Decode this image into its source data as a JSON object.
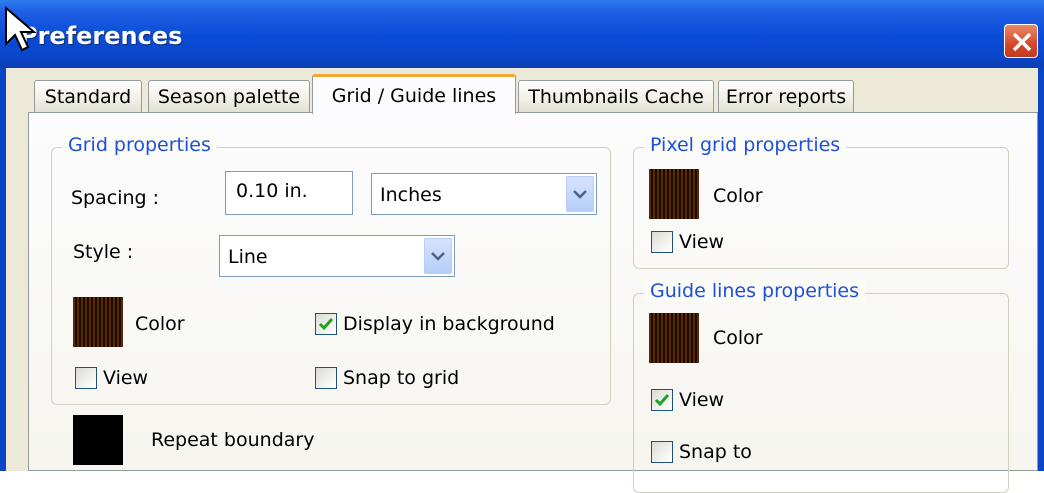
{
  "window": {
    "title": "Preferences",
    "close_icon": "close-icon"
  },
  "tabs": [
    {
      "label": "Standard",
      "active": false
    },
    {
      "label": "Season palette",
      "active": false
    },
    {
      "label": "Grid / Guide lines",
      "active": true
    },
    {
      "label": "Thumbnails Cache",
      "active": false
    },
    {
      "label": "Error reports",
      "active": false
    }
  ],
  "grid_properties": {
    "title": "Grid properties",
    "spacing_label": "Spacing :",
    "spacing_value": "0.10 in.",
    "unit_value": "Inches",
    "style_label": "Style :",
    "style_value": "Line",
    "color_label": "Color",
    "display_in_background_label": "Display in background",
    "display_in_background_checked": true,
    "view_label": "View",
    "view_checked": false,
    "snap_to_grid_label": "Snap to grid",
    "snap_to_grid_checked": false
  },
  "repeat_boundary": {
    "label": "Repeat boundary",
    "color": "#000000"
  },
  "pixel_grid_properties": {
    "title": "Pixel grid properties",
    "color_label": "Color",
    "view_label": "View",
    "view_checked": false
  },
  "guide_lines_properties": {
    "title": "Guide lines properties",
    "color_label": "Color",
    "view_label": "View",
    "view_checked": true,
    "snap_to_label": "Snap to",
    "snap_to_checked": false
  },
  "colors": {
    "titlebar": "#0a45c8",
    "group_title": "#1f4fd8",
    "grid_color_swatch": "#5b2a00"
  }
}
